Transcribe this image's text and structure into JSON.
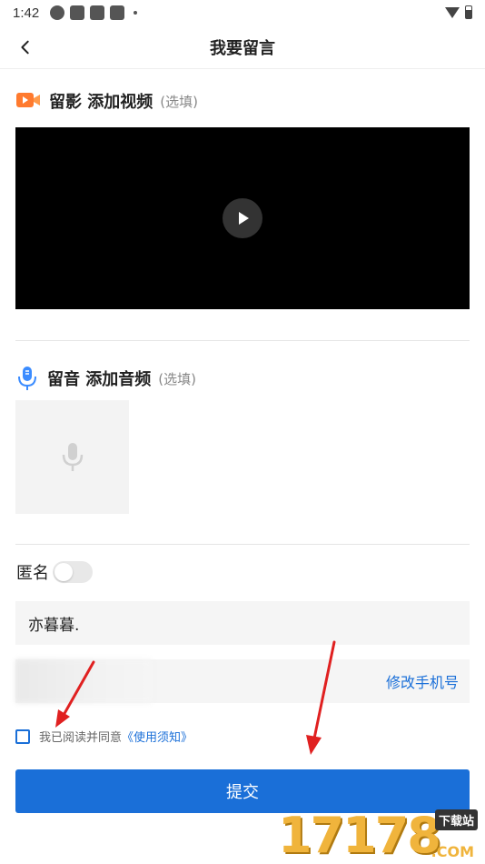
{
  "status_bar": {
    "time": "1:42",
    "icons": [
      "app-icon",
      "square-icon",
      "square-icon",
      "square-icon",
      "dot-icon"
    ],
    "right_icons": [
      "wifi-icon",
      "battery-icon"
    ]
  },
  "header": {
    "back_icon": "chevron-left-icon",
    "title": "我要留言"
  },
  "video_section": {
    "icon": "video-icon",
    "icon_color": "#ff7a2e",
    "title": "留影 添加视频",
    "optional": "(选填)",
    "play_icon": "play-icon"
  },
  "audio_section": {
    "icon": "microphone-icon",
    "icon_color": "#3b8cff",
    "title": "留音 添加音频",
    "optional": "(选填)",
    "placeholder_icon": "microphone-icon"
  },
  "anonymous": {
    "label": "匿名",
    "enabled": false
  },
  "form": {
    "name_value": "亦暮暮.",
    "change_phone_label": "修改手机号"
  },
  "agreement": {
    "checked": false,
    "text": "我已阅读并同意",
    "link": "《使用须知》"
  },
  "submit": {
    "label": "提交",
    "color": "#1a6fd8"
  },
  "watermark": {
    "digits": "17178",
    "tag": "下载站",
    "domain": ".COM"
  }
}
